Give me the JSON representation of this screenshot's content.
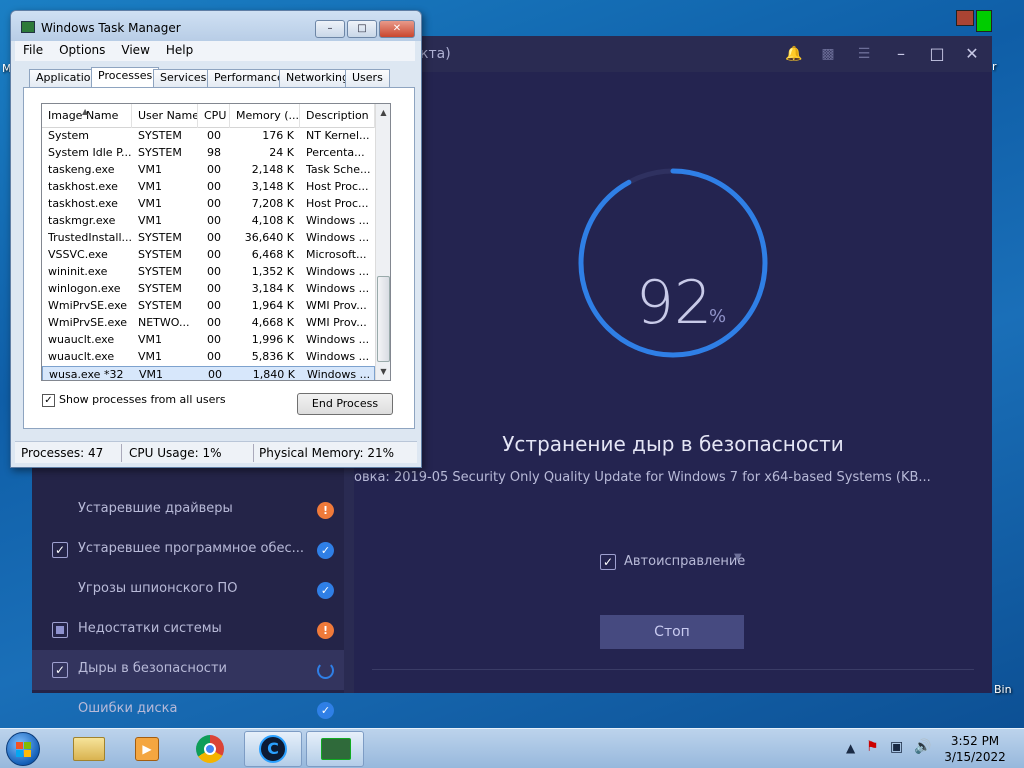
{
  "desktop": {
    "left_edge_label": "M",
    "right_edge_label": "r",
    "recycle_label": "Bin"
  },
  "optimizer": {
    "title_fragment": "кта)",
    "progress_percent": 92,
    "percent_symbol": "%",
    "heading": "Устранение дыр в безопасности",
    "subtext": "овка: 2019-05 Security Only Quality Update for Windows 7 for x64-based Systems (KB...",
    "autofix_label": "Автоисправление",
    "stop_label": "Стоп",
    "nav": [
      {
        "label": "Устаревшие драйверы",
        "check": "none",
        "status": "warn"
      },
      {
        "label": "Устаревшее программное обес...",
        "check": "checked",
        "status": "ok"
      },
      {
        "label": "Угрозы шпионского ПО",
        "check": "none",
        "status": "ok"
      },
      {
        "label": "Недостатки системы",
        "check": "partial",
        "status": "warn"
      },
      {
        "label": "Дыры в безопасности",
        "check": "checked",
        "status": "spin"
      },
      {
        "label": "Ошибки диска",
        "check": "none",
        "status": "ok"
      }
    ],
    "colors": {
      "bg": "#2a2b52",
      "accent": "#2f7fe6",
      "warn": "#f07a3a"
    }
  },
  "taskmgr": {
    "title": "Windows Task Manager",
    "menu": [
      "File",
      "Options",
      "View",
      "Help"
    ],
    "tabs": [
      "Applications",
      "Processes",
      "Services",
      "Performance",
      "Networking",
      "Users"
    ],
    "active_tab": "Processes",
    "columns": [
      "Image Name",
      "User Name",
      "CPU",
      "Memory (...",
      "Description"
    ],
    "rows": [
      [
        "System",
        "SYSTEM",
        "00",
        "176 K",
        "NT Kernel..."
      ],
      [
        "System Idle P...",
        "SYSTEM",
        "98",
        "24 K",
        "Percenta..."
      ],
      [
        "taskeng.exe",
        "VM1",
        "00",
        "2,148 K",
        "Task Sche..."
      ],
      [
        "taskhost.exe",
        "VM1",
        "00",
        "3,148 K",
        "Host Proc..."
      ],
      [
        "taskhost.exe",
        "VM1",
        "00",
        "7,208 K",
        "Host Proc..."
      ],
      [
        "taskmgr.exe",
        "VM1",
        "00",
        "4,108 K",
        "Windows ..."
      ],
      [
        "TrustedInstall...",
        "SYSTEM",
        "00",
        "36,640 K",
        "Windows ..."
      ],
      [
        "VSSVC.exe",
        "SYSTEM",
        "00",
        "6,468 K",
        "Microsoft..."
      ],
      [
        "wininit.exe",
        "SYSTEM",
        "00",
        "1,352 K",
        "Windows ..."
      ],
      [
        "winlogon.exe",
        "SYSTEM",
        "00",
        "3,184 K",
        "Windows ..."
      ],
      [
        "WmiPrvSE.exe",
        "SYSTEM",
        "00",
        "1,964 K",
        "WMI Prov..."
      ],
      [
        "WmiPrvSE.exe",
        "NETWO...",
        "00",
        "4,668 K",
        "WMI Prov..."
      ],
      [
        "wuauclt.exe",
        "VM1",
        "00",
        "1,996 K",
        "Windows ..."
      ],
      [
        "wuauclt.exe",
        "VM1",
        "00",
        "5,836 K",
        "Windows ..."
      ],
      [
        "wusa.exe *32",
        "VM1",
        "00",
        "1,840 K",
        "Windows ..."
      ]
    ],
    "selected_row": 14,
    "show_all_label": "Show processes from all users",
    "show_all_checked": true,
    "end_process_label": "End Process",
    "status": {
      "processes": "Processes: 47",
      "cpu": "CPU Usage: 1%",
      "memory": "Physical Memory: 21%"
    }
  },
  "taskbar": {
    "apps": [
      "start-button",
      "file-explorer",
      "media-player",
      "chrome",
      "ccleaner-app",
      "task-manager"
    ],
    "time": "3:52 PM",
    "date": "3/15/2022"
  }
}
